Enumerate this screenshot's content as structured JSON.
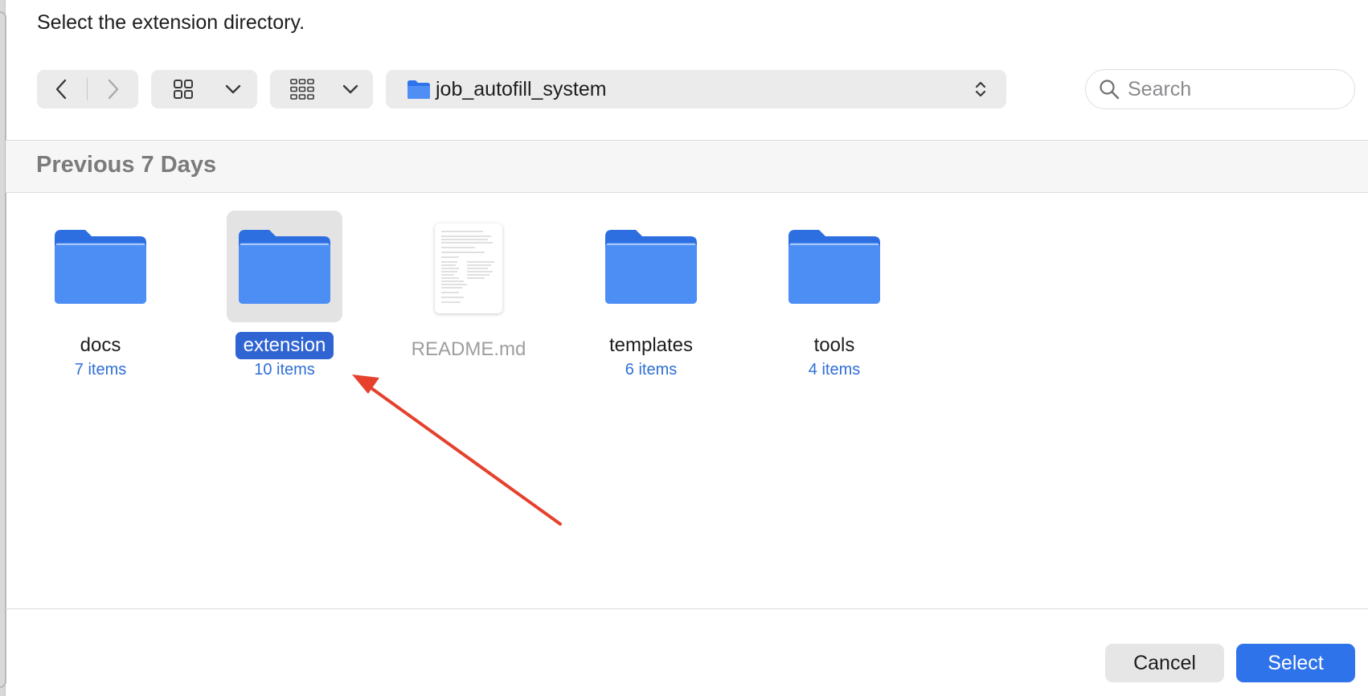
{
  "dialog": {
    "prompt": "Select the extension directory."
  },
  "toolbar": {
    "back_icon": "chevron-left-icon",
    "forward_icon": "chevron-right-icon",
    "view_icon": "icon-grid-icon",
    "group_icon": "group-grid-icon",
    "location": "job_autofill_system",
    "search_placeholder": "Search"
  },
  "section": {
    "title": "Previous 7 Days"
  },
  "items": [
    {
      "name": "docs",
      "count": "7 items",
      "kind": "folder",
      "selected": false
    },
    {
      "name": "extension",
      "count": "10 items",
      "kind": "folder",
      "selected": true
    },
    {
      "name": "README.md",
      "count": "",
      "kind": "document",
      "selected": false,
      "disabled": true
    },
    {
      "name": "templates",
      "count": "6 items",
      "kind": "folder",
      "selected": false
    },
    {
      "name": "tools",
      "count": "4 items",
      "kind": "folder",
      "selected": false
    }
  ],
  "buttons": {
    "cancel": "Cancel",
    "select": "Select"
  },
  "colors": {
    "accent": "#2f73ea",
    "selection": "#2f64d2",
    "folder": "#3b82f0",
    "annotation_arrow": "#e5412d"
  }
}
